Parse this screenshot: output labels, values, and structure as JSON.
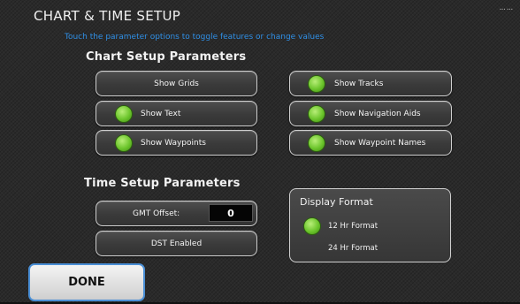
{
  "header": {
    "title": "CHART & TIME SETUP",
    "corner_mark": "••• •••",
    "instructions": "Touch the parameter options to toggle features or change values"
  },
  "chart_setup": {
    "heading": "Chart Setup Parameters",
    "options": [
      {
        "label": "Show Grids",
        "enabled": false
      },
      {
        "label": "Show Tracks",
        "enabled": true
      },
      {
        "label": "Show Text",
        "enabled": true
      },
      {
        "label": "Show Navigation Aids",
        "enabled": true
      },
      {
        "label": "Show Waypoints",
        "enabled": true
      },
      {
        "label": "Show Waypoint Names",
        "enabled": true
      }
    ]
  },
  "time_setup": {
    "heading": "Time Setup Parameters",
    "gmt_offset_label": "GMT Offset:",
    "gmt_offset_value": "0",
    "dst_label": "DST Enabled",
    "dst_enabled": false
  },
  "display_format": {
    "heading": "Display Format",
    "options": [
      {
        "label": "12 Hr Format",
        "selected": true
      },
      {
        "label": "24 Hr Format",
        "selected": false
      }
    ]
  },
  "done_label": "DONE",
  "colors": {
    "accent_blue": "#2f8fe6",
    "indicator_green": "#6cc52c",
    "button_border": "#cfcfcf"
  }
}
